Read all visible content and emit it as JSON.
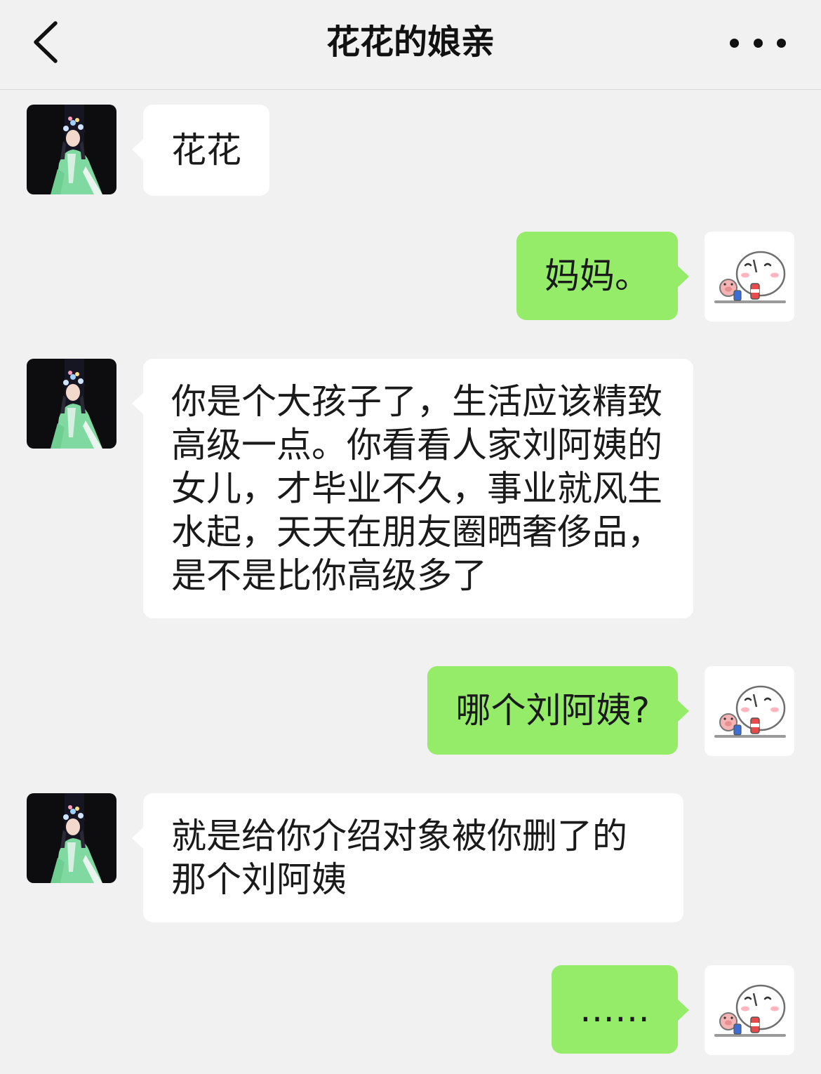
{
  "header": {
    "title": "花花的娘亲",
    "back_icon": "chevron-left-icon",
    "more_icon": "more-dots-icon"
  },
  "contacts": {
    "mother_avatar": "opera-performer-avatar",
    "self_avatar": "cartoon-bun-avatar"
  },
  "messages": [
    {
      "from": "mother",
      "text": "花花"
    },
    {
      "from": "self",
      "text": "妈妈。"
    },
    {
      "from": "mother",
      "text": "你是个大孩子了，生活应该精致高级一点。你看看人家刘阿姨的女儿，才毕业不久，事业就风生水起，天天在朋友圈晒奢侈品，是不是比你高级多了"
    },
    {
      "from": "self",
      "text": "哪个刘阿姨?"
    },
    {
      "from": "mother",
      "text": "就是给你介绍对象被你删了的那个刘阿姨"
    },
    {
      "from": "self",
      "text": "……"
    }
  ],
  "colors": {
    "background": "#f1f1f1",
    "incoming_bubble": "#ffffff",
    "outgoing_bubble": "#95ec69",
    "text": "#1a1a1a"
  }
}
